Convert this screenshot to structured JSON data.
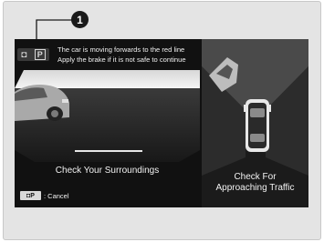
{
  "callout": {
    "number": "1"
  },
  "rear_camera": {
    "mode_icon_glyph": "◘",
    "mode_icon_letter": "P",
    "warning_line1": "The car is moving forwards to the red line",
    "warning_line2": "Apply the brake if it is not safe to continue",
    "surroundings_label": "Check Your Surroundings"
  },
  "top_view": {
    "traffic_line1": "Check For",
    "traffic_line2": "Approaching Traffic"
  },
  "cancel": {
    "icon_label": "◘P",
    "label": ": Cancel"
  },
  "colors": {
    "screen_bg": "#111111",
    "frame_bg": "#e4e4e4",
    "text": "#f2f2f2",
    "ground_line": "#e6e6e6"
  }
}
